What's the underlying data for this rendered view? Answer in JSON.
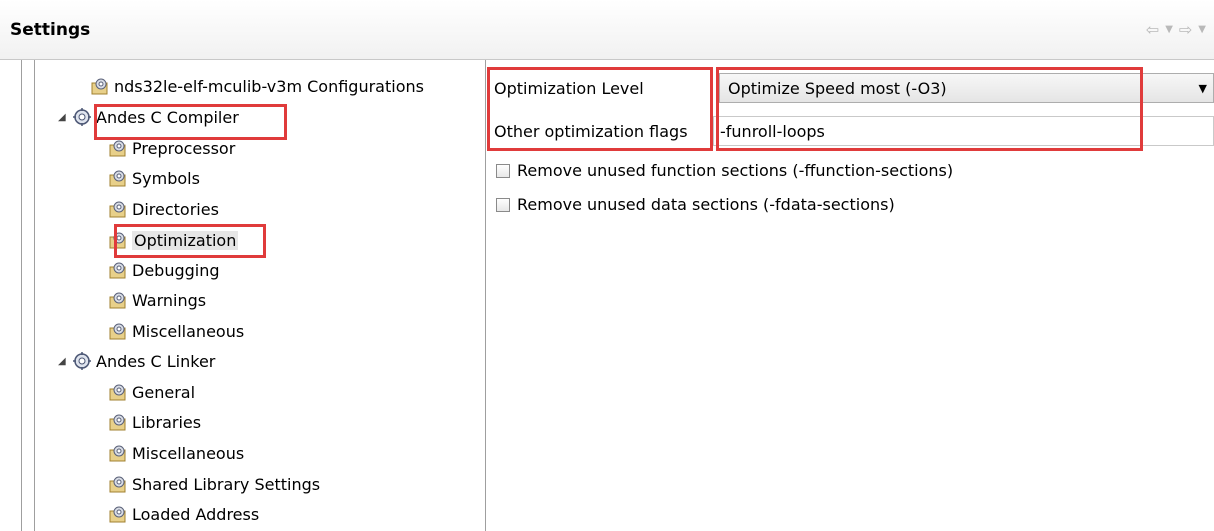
{
  "header": {
    "title": "Settings"
  },
  "nav": {
    "back_icon": "back-arrow-icon",
    "forward_icon": "forward-arrow-icon"
  },
  "tree": {
    "items": [
      {
        "label": "nds32le-elf-mculib-v3m Configurations",
        "level": 1
      },
      {
        "label": "Andes C Compiler",
        "level": 0,
        "expanded": true
      },
      {
        "label": "Preprocessor",
        "level": 1
      },
      {
        "label": "Symbols",
        "level": 1
      },
      {
        "label": "Directories",
        "level": 1
      },
      {
        "label": "Optimization",
        "level": 1,
        "selected": true
      },
      {
        "label": "Debugging",
        "level": 1
      },
      {
        "label": "Warnings",
        "level": 1
      },
      {
        "label": "Miscellaneous",
        "level": 1
      },
      {
        "label": "Andes C Linker",
        "level": 0,
        "expanded": true
      },
      {
        "label": "General",
        "level": 1
      },
      {
        "label": "Libraries",
        "level": 1
      },
      {
        "label": "Miscellaneous",
        "level": 1
      },
      {
        "label": "Shared Library Settings",
        "level": 1
      },
      {
        "label": "Loaded Address",
        "level": 1
      }
    ]
  },
  "optimization": {
    "level_label": "Optimization Level",
    "level_value": "Optimize Speed most (-O3)",
    "flags_label": "Other optimization flags",
    "flags_value": "-funroll-loops",
    "options": [
      {
        "label": "Remove unused function sections (-ffunction-sections)",
        "checked": false
      },
      {
        "label": "Remove unused data sections (-fdata-sections)",
        "checked": false
      }
    ]
  },
  "colors": {
    "highlight_box": "#e03b3b"
  }
}
